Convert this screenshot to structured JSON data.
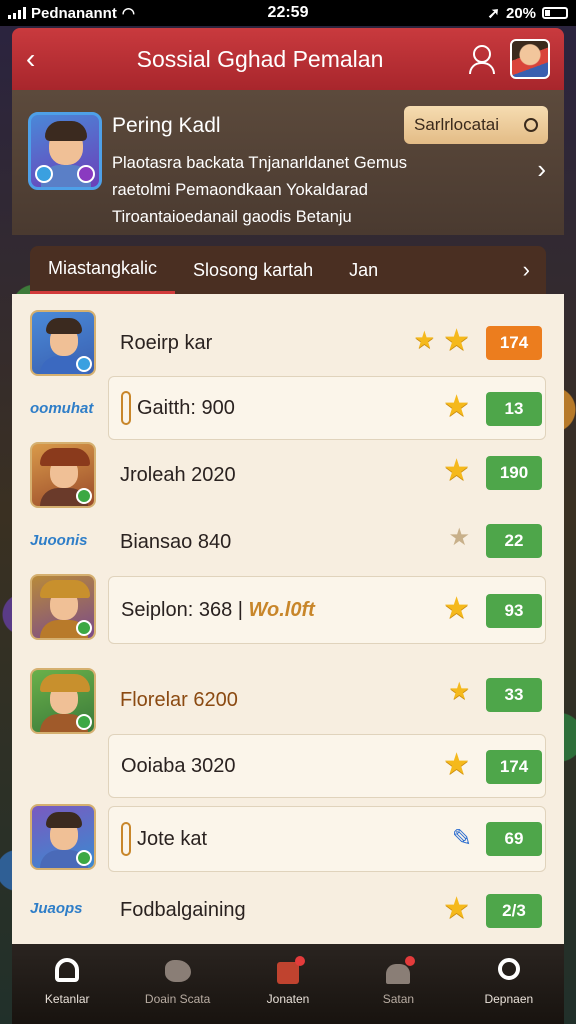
{
  "status_bar": {
    "carrier": "Pednanannt",
    "time": "22:59",
    "battery": "20%"
  },
  "header": {
    "title": "Sossial Gghad Pemalan"
  },
  "profile": {
    "name": "Pering Kadl",
    "description": "Plaotasra backata Tnjanarldanet Gemus raetolmi Pemaondkaan Yokaldarad Tiroantaioedanail gaodis Betanju",
    "action_label": "Sarlrlocatai"
  },
  "tabs": [
    {
      "label": "Miastangkalic"
    },
    {
      "label": "Slosong kartah"
    },
    {
      "label": "Jan"
    }
  ],
  "rows": [
    {
      "name": "Roeirp kar",
      "score": "174",
      "stars": 2
    },
    {
      "side_tag": "oomuhat",
      "name": "Gaitth: 900",
      "score": "13",
      "stars": 1
    },
    {
      "name": "Jroleah 2020",
      "score": "190",
      "stars": 1
    },
    {
      "side_tag": "Juoonis",
      "name": "Biansao 840",
      "score": "22",
      "stars": 1
    },
    {
      "name": "Seiplon: 368 |",
      "name_suffix": "Wo.l0ft",
      "score": "93",
      "stars": 1
    },
    {
      "name": "Florelar 6200",
      "score": "33",
      "stars": 1
    },
    {
      "name": "Ooiaba 3020",
      "score": "174",
      "stars": 1
    },
    {
      "name": "Jote kat",
      "score": "69",
      "stars": 0
    },
    {
      "side_tag": "Juaops",
      "name": "Fodbalgaining",
      "score": "2/3",
      "stars": 1
    }
  ],
  "bottom_nav": [
    {
      "label": "Ketanlar"
    },
    {
      "label": "Doain Scata"
    },
    {
      "label": "Jonaten"
    },
    {
      "label": "Satan"
    },
    {
      "label": "Depnaen"
    }
  ],
  "colors": {
    "header_red": "#c93a3e",
    "score_green": "#4ea64a",
    "score_orange": "#ec7d1e",
    "star_gold": "#f5b91c"
  },
  "icons": [
    "back-icon",
    "user-icon",
    "avatar",
    "chevron-right-icon",
    "star-icon",
    "home-icon",
    "gift-icon",
    "people-icon",
    "profile-icon"
  ]
}
